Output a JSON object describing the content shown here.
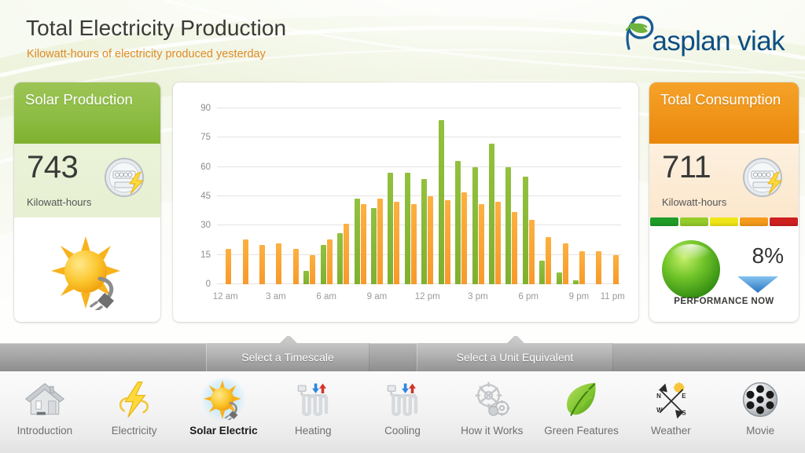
{
  "header": {
    "title": "Total Electricity Production",
    "subtitle": "Kilowatt-hours of electricity produced yesterday",
    "logo_text": "asplan viak",
    "logo_mark": "leaf-swoosh-icon"
  },
  "left_panel": {
    "heading": "Solar Production",
    "value": "743",
    "unit": "Kilowatt-hours",
    "meter_icon": "electric-meter-icon",
    "illustration_icon": "sun-plug-icon",
    "accent": "#8fbe46"
  },
  "right_panel": {
    "heading": "Total Consumption",
    "value": "711",
    "unit": "Kilowatt-hours",
    "meter_icon": "electric-meter-icon",
    "performance_percent": "8%",
    "performance_caption": "PERFORMANCE NOW",
    "performance_orb": "green-orb-icon",
    "performance_arrow": "arrow-down-icon",
    "accent": "#ef920f",
    "scale_colors": [
      "#1f9c27",
      "#95cc2a",
      "#f0e518",
      "#f49a1c",
      "#cf2020"
    ]
  },
  "tabs": [
    {
      "label": "Select a Timescale"
    },
    {
      "label": "Select a Unit Equivalent"
    }
  ],
  "nav": {
    "items": [
      {
        "label": "Introduction",
        "icon": "house-icon",
        "active": false
      },
      {
        "label": "Electricity",
        "icon": "lightning-bolt-icon",
        "active": false
      },
      {
        "label": "Solar Electric",
        "icon": "sun-plug-icon",
        "active": true
      },
      {
        "label": "Heating",
        "icon": "radiator-hot-icon",
        "active": false
      },
      {
        "label": "Cooling",
        "icon": "radiator-cool-icon",
        "active": false
      },
      {
        "label": "How it Works",
        "icon": "gears-icon",
        "active": false
      },
      {
        "label": "Green Features",
        "icon": "leaf-icon",
        "active": false
      },
      {
        "label": "Weather",
        "icon": "weathervane-icon",
        "active": false
      },
      {
        "label": "Movie",
        "icon": "film-reel-icon",
        "active": false
      }
    ]
  },
  "chart_data": {
    "type": "bar",
    "title": "Total Electricity Production",
    "subtitle": "Kilowatt-hours of electricity produced yesterday",
    "xlabel": "",
    "ylabel": "",
    "ylim": [
      0,
      90
    ],
    "yticks": [
      0,
      15,
      30,
      45,
      60,
      75,
      90
    ],
    "grid": true,
    "legend": "none",
    "xtick_labels": [
      "12 am",
      "3 am",
      "6 am",
      "9 am",
      "12 pm",
      "3 pm",
      "6 pm",
      "9 pm",
      "11 pm"
    ],
    "xtick_indices": [
      0,
      3,
      6,
      9,
      12,
      15,
      18,
      21,
      23
    ],
    "categories": [
      "12 am",
      "1 am",
      "2 am",
      "3 am",
      "4 am",
      "5 am",
      "6 am",
      "7 am",
      "8 am",
      "9 am",
      "10 am",
      "11 am",
      "12 pm",
      "1 pm",
      "2 pm",
      "3 pm",
      "4 pm",
      "5 pm",
      "6 pm",
      "7 pm",
      "8 pm",
      "9 pm",
      "10 pm",
      "11 pm"
    ],
    "series": [
      {
        "name": "Solar Production",
        "color": "#85b736",
        "values": [
          0,
          0,
          0,
          0,
          0,
          7,
          20,
          26,
          44,
          39,
          57,
          57,
          54,
          84,
          63,
          60,
          72,
          60,
          55,
          12,
          6,
          2,
          0,
          0
        ]
      },
      {
        "name": "Total Consumption",
        "color": "#f9a435",
        "values": [
          18,
          23,
          20,
          21,
          18,
          15,
          23,
          31,
          41,
          44,
          42,
          41,
          45,
          43,
          47,
          41,
          42,
          37,
          33,
          24,
          21,
          17,
          17,
          15
        ]
      }
    ]
  }
}
